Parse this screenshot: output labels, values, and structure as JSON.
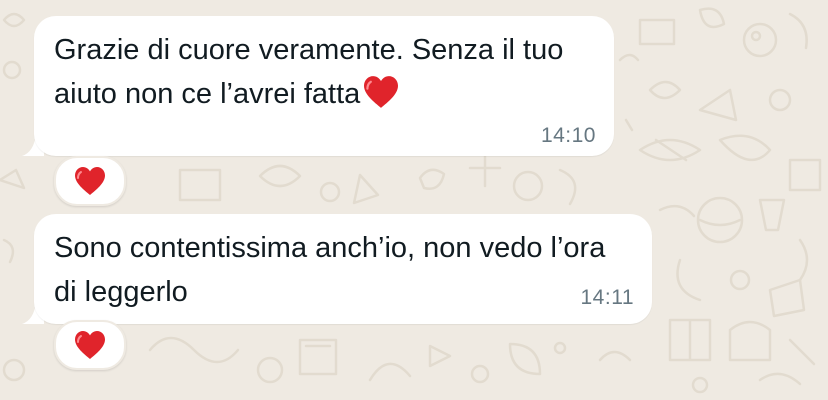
{
  "chat": {
    "messages": [
      {
        "text": "Grazie di cuore veramente. Senza il tuo aiuto non ce l’avrei fatta",
        "emoji": "red-heart",
        "time": "14:10",
        "reaction": "red-heart"
      },
      {
        "text": "Sono contentissima anch’io, non vedo l’ora di leggerlo",
        "time": "14:11",
        "reaction": "red-heart"
      }
    ]
  },
  "colors": {
    "background": "#efeae2",
    "bubble": "#ffffff",
    "text": "#111b21",
    "timestamp": "#667781",
    "heart": "#e0242b"
  }
}
